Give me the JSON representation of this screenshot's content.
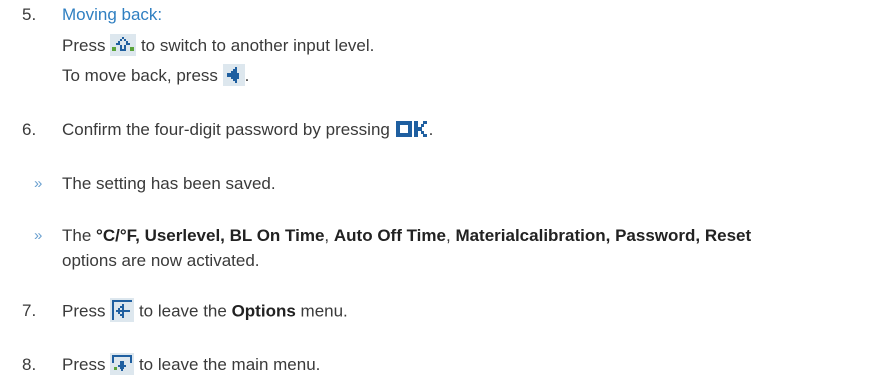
{
  "steps": {
    "s5": {
      "number": "5.",
      "heading": "Moving back:",
      "line1_a": "Press",
      "line1_b": "to switch to another input level.",
      "line2_a": "To move back, press",
      "line2_b": "."
    },
    "s6": {
      "number": "6.",
      "text_a": "Confirm the four-digit password by pressing",
      "text_b": "."
    },
    "r1": {
      "marker": "»",
      "text": "The setting has been saved."
    },
    "r2": {
      "marker": "»",
      "text_a": "The",
      "opt1": "°C/°F, Userlevel, BL On Time",
      "sep1": ",",
      "opt2": "Auto Off Time",
      "sep2": ",",
      "opt3": "Materialcalibration, Password, Reset",
      "line2": "options are now activated."
    },
    "s7": {
      "number": "7.",
      "text_a": "Press",
      "text_b": "to leave the",
      "bold": "Options",
      "text_c": "menu."
    },
    "s8": {
      "number": "8.",
      "text_a": "Press",
      "text_b": "to leave the main menu."
    }
  },
  "icons": {
    "shift": "shift-up-arrow-icon",
    "back": "back-arrow-icon",
    "ok": "ok-button-icon",
    "exit_options": "exit-options-icon",
    "exit_main": "exit-main-menu-icon"
  },
  "colors": {
    "heading": "#2f7fc1",
    "text": "#3a3a3a",
    "marker": "#6aa0cf",
    "icon_bg": "#dde7ee",
    "icon_pixel": "#1f5fa0"
  }
}
